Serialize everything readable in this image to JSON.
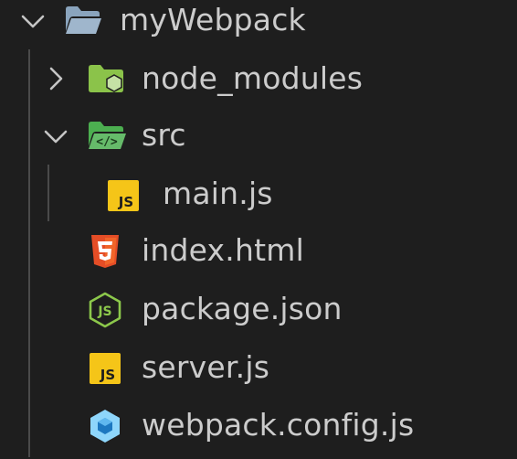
{
  "tree": {
    "root": {
      "label": "myWebpack",
      "expanded": true,
      "icon": "folder-open-icon",
      "children": [
        {
          "label": "node_modules",
          "type": "folder",
          "expanded": false,
          "icon": "folder-node-icon"
        },
        {
          "label": "src",
          "type": "folder",
          "expanded": true,
          "icon": "folder-src-icon",
          "children": [
            {
              "label": "main.js",
              "type": "file",
              "icon": "javascript-icon"
            }
          ]
        },
        {
          "label": "index.html",
          "type": "file",
          "icon": "html5-icon"
        },
        {
          "label": "package.json",
          "type": "file",
          "icon": "nodejs-icon"
        },
        {
          "label": "server.js",
          "type": "file",
          "icon": "javascript-icon"
        },
        {
          "label": "webpack.config.js",
          "type": "file",
          "icon": "webpack-icon"
        }
      ]
    }
  },
  "icon_text": {
    "js": "JS"
  },
  "colors": {
    "background": "#1e1e1e",
    "text": "#cccccc",
    "folder_root": "#8aa4bd",
    "folder_node": "#8bc34a",
    "folder_src": "#4caf50",
    "js_badge": "#f5c518",
    "html5": "#e44d26",
    "nodejs": "#8cc84b",
    "webpack": "#8ed6fb"
  }
}
